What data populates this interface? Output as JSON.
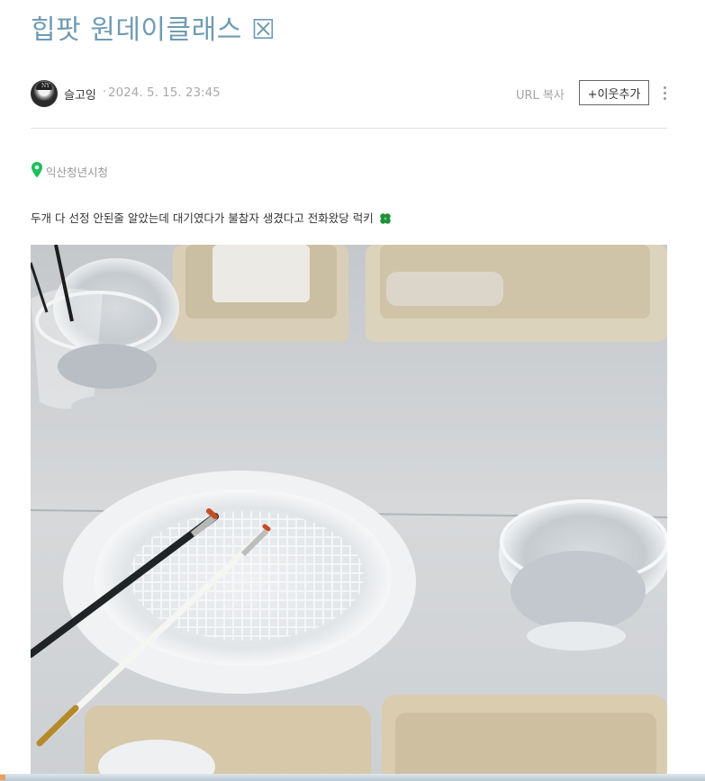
{
  "post": {
    "title": "힙팟 원데이클래스 ☒",
    "author": "슬고잉",
    "separator": "·",
    "date": "2024. 5. 15. 23:45",
    "url_copy": "URL 복사",
    "follow": "+이웃추가"
  },
  "location": {
    "name": "익산청년시청"
  },
  "body": {
    "text": "두개 다 선정 안된줄 알았는데 대기였다가 불참자 생겼다고 전화왔당 럭키"
  },
  "avatar": {
    "cap_text": "NY"
  },
  "icons": {
    "pin": "map-pin-icon",
    "clover": "four-leaf-clover-icon",
    "more": "vertical-dots-icon"
  },
  "colors": {
    "title": "#6f9bb3",
    "pin": "#19c157",
    "clover": "#1f8f3a"
  }
}
